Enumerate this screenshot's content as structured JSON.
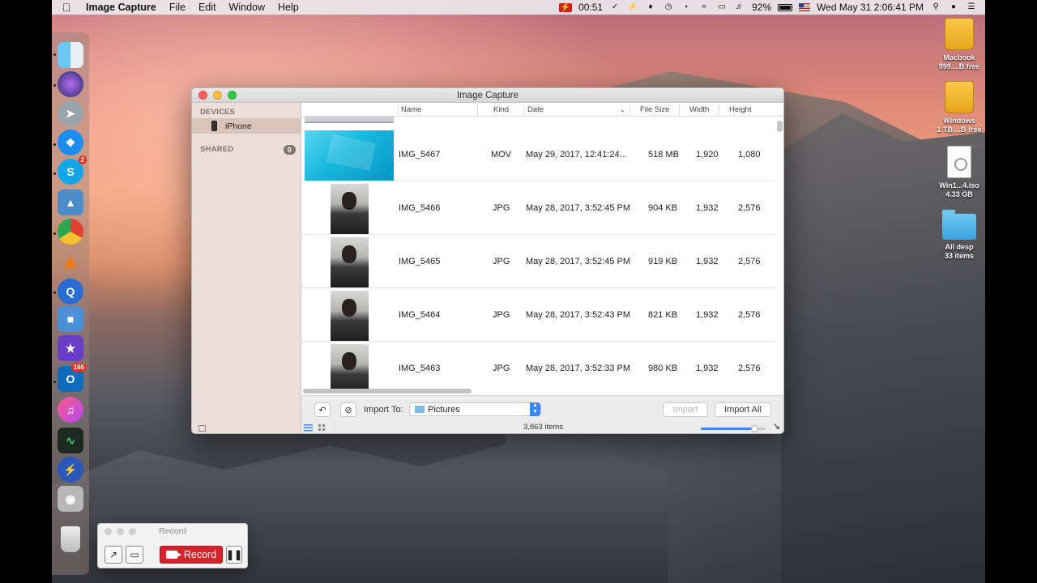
{
  "menubar": {
    "app_name": "Image Capture",
    "menus": [
      "File",
      "Edit",
      "Window",
      "Help"
    ],
    "recording_time": "00:51",
    "battery": "92%",
    "datetime": "Wed May 31  2:06:41 PM"
  },
  "desktop": [
    {
      "label1": "Macbook",
      "label2": "999....B free",
      "kind": "drive"
    },
    {
      "label1": "Windows",
      "label2": "1 TB,...B free",
      "kind": "drive"
    },
    {
      "label1": "Win1...4.iso",
      "label2": "4.33 GB",
      "kind": "file"
    },
    {
      "label1": "All desp",
      "label2": "33 items",
      "kind": "folder"
    }
  ],
  "dock": {
    "skype_badge": "2",
    "outlook_badge": "165"
  },
  "window": {
    "title": "Image Capture",
    "sidebar": {
      "devices_header": "DEVICES",
      "device_name": "iPhone",
      "shared_header": "SHARED",
      "shared_count": "0"
    },
    "columns": {
      "name": "Name",
      "kind": "Kind",
      "date": "Date",
      "size": "File Size",
      "width": "Width",
      "height": "Height"
    },
    "rows": [
      {
        "name": "IMG_5467",
        "kind": "MOV",
        "date": "May 29, 2017, 12:41:24...",
        "size": "518 MB",
        "width": "1,920",
        "height": "1,080"
      },
      {
        "name": "IMG_5466",
        "kind": "JPG",
        "date": "May 28, 2017, 3:52:45 PM",
        "size": "904 KB",
        "width": "1,932",
        "height": "2,576"
      },
      {
        "name": "IMG_5465",
        "kind": "JPG",
        "date": "May 28, 2017, 3:52:45 PM",
        "size": "919 KB",
        "width": "1,932",
        "height": "2,576"
      },
      {
        "name": "IMG_5464",
        "kind": "JPG",
        "date": "May 28, 2017, 3:52:43 PM",
        "size": "821 KB",
        "width": "1,932",
        "height": "2,576"
      },
      {
        "name": "IMG_5463",
        "kind": "JPG",
        "date": "May 28, 2017, 3:52:33 PM",
        "size": "980 KB",
        "width": "1,932",
        "height": "2,576"
      }
    ],
    "toolbar": {
      "import_to_label": "Import To:",
      "import_to_value": "Pictures",
      "import_button": "Import",
      "import_all_button": "Import All",
      "items_count": "3,863 items"
    }
  },
  "record_widget": {
    "title": "Record",
    "record_button": "Record"
  }
}
